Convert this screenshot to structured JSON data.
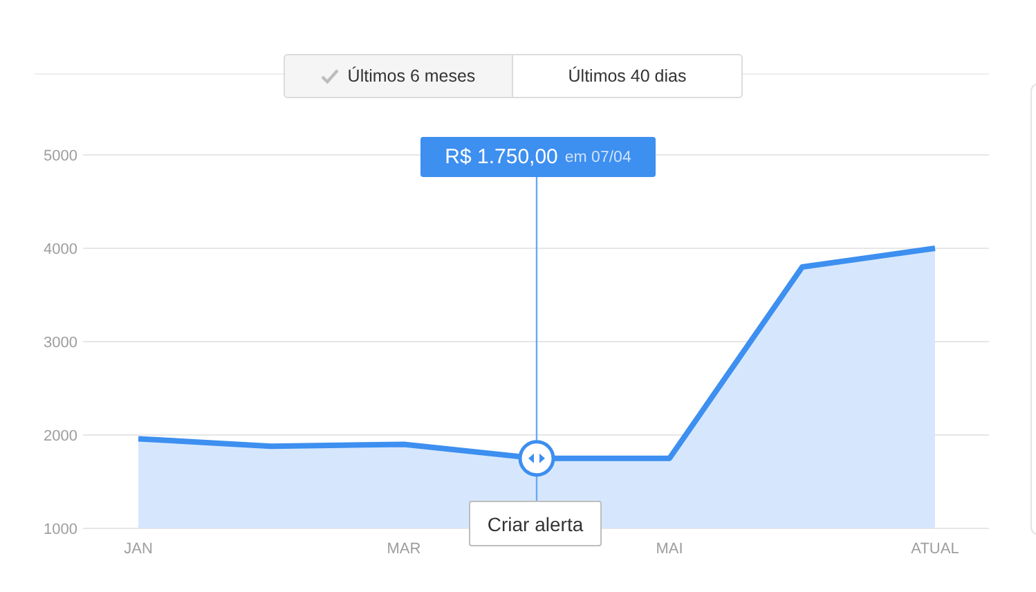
{
  "range_toggle": [
    {
      "label": "Últimos 6 meses",
      "selected": true
    },
    {
      "label": "Últimos 40 dias",
      "selected": false
    }
  ],
  "chart": {
    "chart_data": {
      "type": "area",
      "categories": [
        "JAN",
        null,
        "MAR",
        null,
        "MAI",
        null,
        "ATUAL"
      ],
      "series": [
        {
          "color": "#3d8ff0",
          "values": [
            1960,
            1880,
            1900,
            1750,
            1750,
            3800,
            4000
          ]
        }
      ],
      "ylim": [
        1000,
        5000
      ],
      "grid": true,
      "yticks": [
        1000,
        2000,
        3000,
        4000,
        5000
      ]
    },
    "tooltip": {
      "value": "R$ 1.750,00",
      "date": "em 07/04"
    },
    "alert_button": "Criar alerta"
  }
}
